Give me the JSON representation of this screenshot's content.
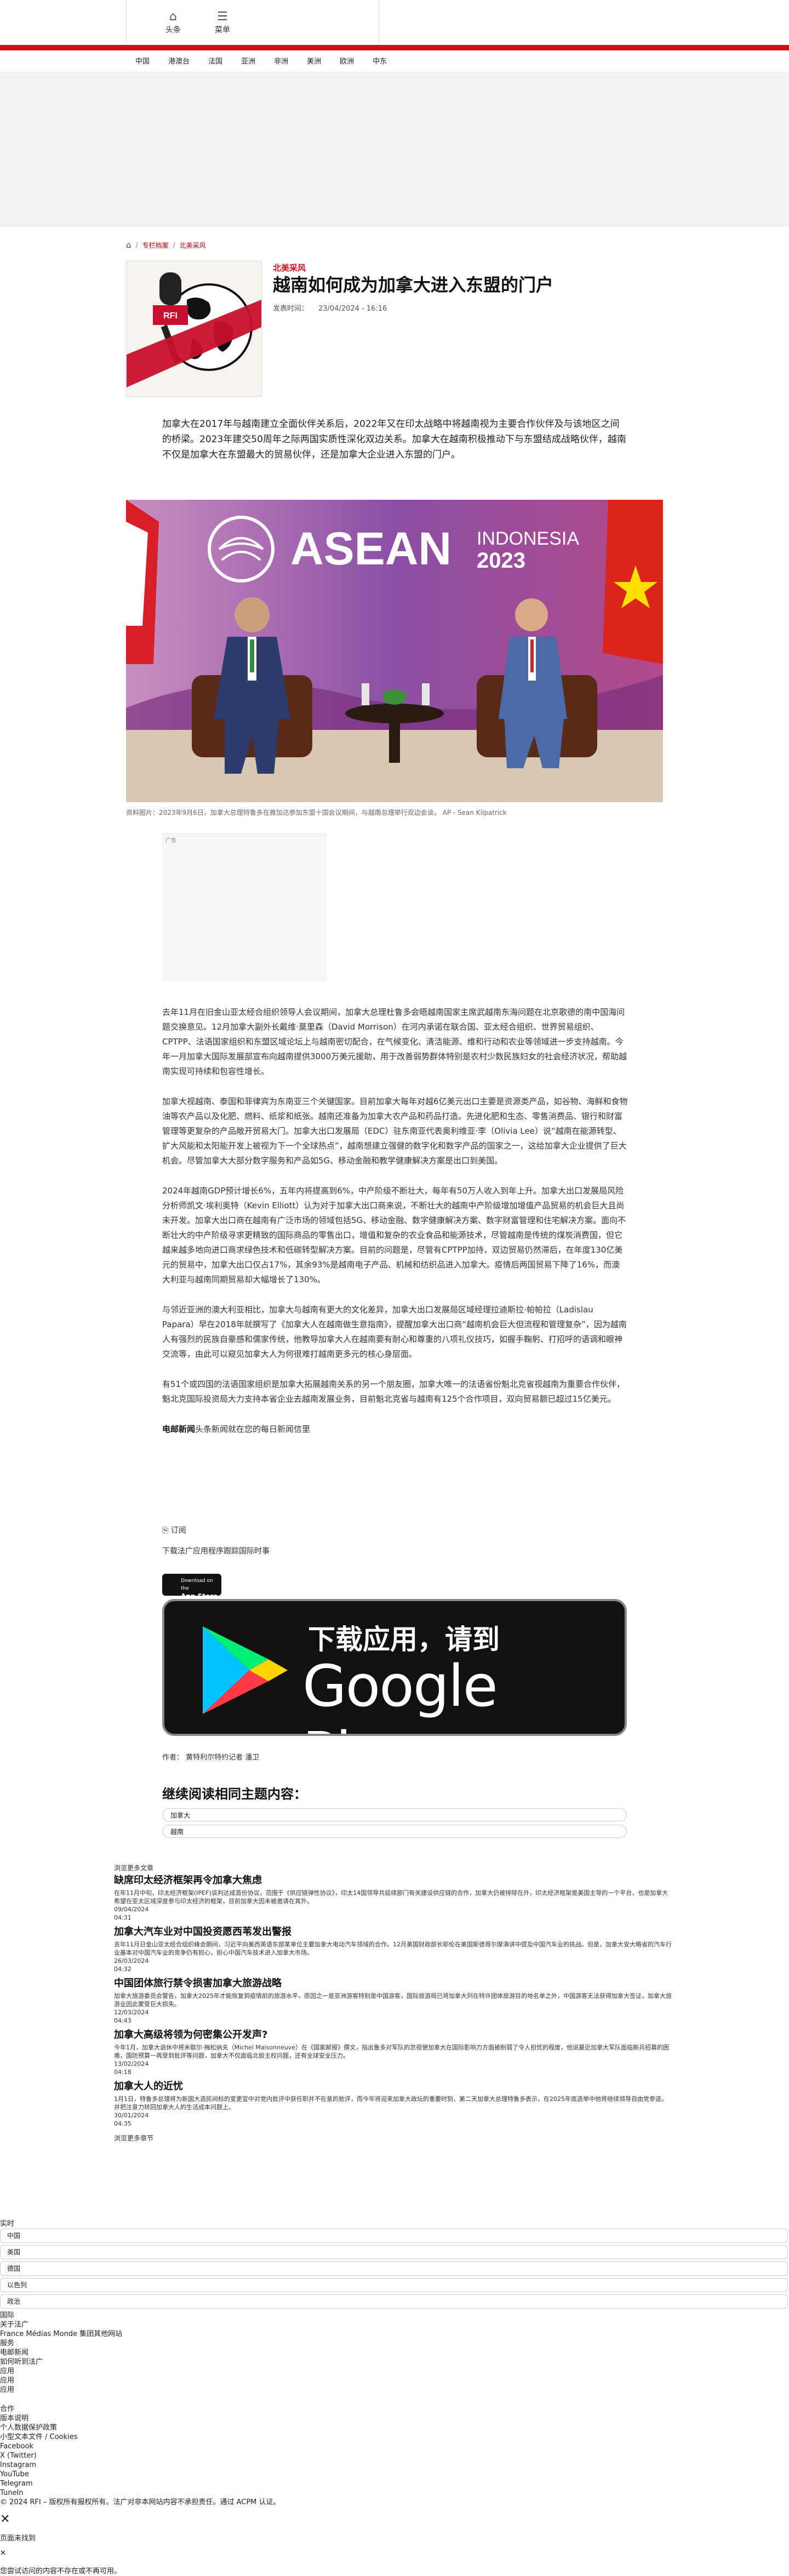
{
  "header": {
    "home_label": "头条",
    "menu_label": "菜单",
    "nav": [
      "中国",
      "港澳台",
      "法国",
      "亚洲",
      "非洲",
      "美洲",
      "欧洲",
      "中东"
    ]
  },
  "breadcrumb": {
    "items": [
      "专栏档案",
      "北美采风"
    ]
  },
  "article": {
    "section": "北美采风",
    "title": "越南如何成为加拿大进入东盟的门户",
    "published_label": "发表时间：",
    "published_date": "23/04/2024 - 16:16",
    "lead": "加拿大在2017年与越南建立全面伙伴关系后，2022年又在印太战略中将越南视为主要合作伙伴及与该地区之间的桥梁。2023年建交50周年之际两国实质性深化双边关系。加拿大在越南积极推动下与东盟结成战略伙伴，越南不仅是加拿大在东盟最大的贸易伙伴，还是加拿大企业进入东盟的门户。",
    "hero_banner_main": "ASEAN",
    "hero_banner_side": "INDONESIA",
    "hero_banner_year": "2023",
    "caption": "资料图片：2023年9月6日，加拿大总理特鲁多在雅加达参加东盟十国会议期间，与越南总理举行双边会谈。 AP - Sean Kilpatrick",
    "ad_label": "广告",
    "paragraphs": [
      "去年11月在旧金山亚太经合组织领导人会议期间，加拿大总理杜鲁多会晤越南国家主席武越南东海问题在北京歌德的南中国海问题交换意见。12月加拿大副外长戴维·莫里森（David Morrison）在河内承诺在联合国、亚太经合组织、世界贸易组织、CPTPP、法语国家组织和东盟区域论坛上与越南密切配合，在气候变化、清洁能源、维和行动和农业等领域进一步支持越南。今年一月加拿大国际发展部宣布向越南提供3000万美元援助，用于改善弱势群体特别是农村少数民族妇女的社会经济状况，帮助越南实现可持续和包容性增长。",
      "加拿大视越南、泰国和菲律宾为东南亚三个关键国家。目前加拿大每年对越6亿美元出口主要是资源类产品，如谷物、海鲜和食物油等农产品以及化肥、燃料、纸浆和纸张。越南还准备为加拿大农产品和药品打造。先进化肥和生态、零售消费品、银行和财富管理等更复杂的产品敞开贸易大门。加拿大出口发展局（EDC）驻东南亚代表奥利维亚·李（Olivia Lee）说“越南在能源转型、扩大风能和太阳能开发上被视为下一个全球热点”，越南想建立强健的数字化和数字产品的国家之一，这给加拿大企业提供了巨大机会。尽管加拿大大部分数字服务和产品如5G、移动金融和教学健康解决方案是出口到美国。",
      "2024年越南GDP预计增长6%，五年内将提高到6%，中产阶级不断壮大，每年有50万人收入到年上升。加拿大出口发展局风险分析师凯文·埃利奥特（Kevin Elliott）认为对于加拿大出口商来说，不断壮大的越南中产阶级增加增值产品贸易的机会巨大且尚未开发。加拿大出口商在越南有广泛市场的领域包括5G、移动金融、数字健康解决方案、数字财富管理和住宅解决方案。面向不断壮大的中产阶级寻求更精致的国际商品的零售出口，增值和复杂的农业食品和能源技术，尽管越南是传统的煤炭消费国，但它越来越多地向进口商求绿色技术和低碳转型解决方案。目前的问题是，尽管有CPTPP加持，双边贸易仍然滞后，在年度130亿美元的贸易中，加拿大出口仅占17%，其余93%是越南电子产品、机械和纺织品进入加拿大。疫情后两国贸易下降了16%，而澳大利亚与越南同期贸易却大幅增长了130%。",
      "与邻近亚洲的澳大利亚相比，加拿大与越南有更大的文化差异，加拿大出口发展局区域经理拉迪斯拉·帕帕拉（Ladislau Papara）早在2018年就撰写了《加拿大人在越南做生意指南》，提醒加拿大出口商“越南机会巨大但流程和管理复杂”，因为越南人有强烈的民族自豪感和儒家传统，他教导加拿大人在越南要有耐心和尊重的八项礼仪技巧，如握手鞠躬、打招呼的语调和眼神交流等，由此可以窥见加拿大人为何很难打越南更多元的核心身层面。",
      "有51个或四国的法语国家组织是加拿大拓展越南关系的另一个朋友圈，加拿大唯一的法语省份魁北克省视越南为重要合作伙伴，魁北克国际投资局大力支持本省企业去越南发展业务，目前魁北克省与越南有125个合作项目，双向贸易额已超过15亿美元。"
    ],
    "newsletter_bold": "电邮新闻",
    "newsletter_text": "头条新闻就在您的每日新闻信里",
    "share_label": "订阅",
    "app_text": "下载法广应用程序跟踪国际时事",
    "app_store_small": "Download on the",
    "app_store_label": "App Store",
    "gplay_line1": "下载应用，请到",
    "gplay_line2": "Google Play",
    "author": "作者：   黄特利尔特约记者 潘卫"
  },
  "related": {
    "title": "继续阅读相同主题内容：",
    "tags": [
      "加拿大",
      "越南"
    ],
    "heading": "浏览更多文章",
    "items": [
      {
        "title": "缺席印太经济框架再令加拿大焦虑",
        "summary": "在年11月中旬，印太经济框架(IPEF)谈判达成首份协议，范围于《供应链弹性协议》，印太14国领导共延续部门有关建设供应链的合作，加拿大仍被排除在外，印太经济框架是美国主导的一个平台，也是加拿大希望在亚太区域深度参与印太经济的框架，目前加拿大因未被邀请在其外。",
        "date": "09/04/2024",
        "time": "04:31"
      },
      {
        "title": "加拿大汽车业对中国投资愿西苇发出警报",
        "summary": "去年11月日金山亚太经合组织峰会期间，习近平向美西英语东部某单位主要加拿大电动汽车领域的合作。12月美国财政部长耶伦在美国斯德哥尔摩演讲中提及中国汽车业的挑战。但是，加拿大安大略省的汽车行业基本对中国汽车业的竞争仍有担心，担心中国汽车技术进入加拿大市场。",
        "date": "26/03/2024",
        "time": "04:32"
      },
      {
        "title": "中国团体旅行禁令损害加拿大旅游战略",
        "summary": "加拿大旅游委员会警告，加拿大2025年才能恢复到疫情前的旅游水平，原因之一是亚洲游客特别是中国游客，国际旅游局已将加拿大列在特许团体旅游目的地名单之外，中国游客无法获得加拿大签证，加拿大旅游业因此蒙受巨大损失。",
        "date": "12/03/2024",
        "time": "04:43"
      },
      {
        "title": "加拿大高级将领为何密集公开发声?",
        "summary": "今年1月，加拿大退休中将米歇尔·梅松纳夫（Michel Maisonneuve）在《国家邮报》撰文，指出鲁多对军队的忽视使加拿大在国际影响力方面被削弱了令人担忧的程度，他说最近加拿大军队面临新兵招募的困难，国防预算一再受到批评等问题，加拿大不仅面临北极主权问题，还有全球安全压力。",
        "date": "13/02/2024",
        "time": "04:18"
      },
      {
        "title": "加拿大人的近忧",
        "summary": "1月1日，特鲁多总理将为新国大选民间标的变更宣中对党内批评中获任职并不在意的批评，而今年将迎来加拿大政坛的重要时刻，第二天加拿大总理特鲁多表示，在2025年底选举中他将继续领导自由党参选，并把注意力转回加拿大人的生活成本问题上。",
        "date": "30/01/2024",
        "time": "04:35"
      }
    ],
    "more": "浏览更多章节"
  },
  "footer": {
    "realtime": "实时",
    "selects": [
      "中国",
      "美国",
      "德国",
      "以色列",
      "政治"
    ],
    "lines": [
      "国际",
      "关于法广",
      "France Médias Monde 集团其他网站",
      "服务",
      "电邮新闻",
      "如何听到法广",
      "应用",
      "应用",
      "应用",
      "合作",
      "版本说明",
      "个人数据保护政策",
      "小型文本文件 / Cookies",
      "Facebook",
      "X (Twitter)",
      "Instagram",
      "YouTube",
      "Telegram",
      "TuneIn",
      "© 2024 RFI – 版权所有报权所有。法广对非本网站内容不承担责任。通过 ACPM 认证。"
    ],
    "not_found": "页面未找到",
    "not_found_desc": "您尝试访问的内容不存在或不再可用。"
  }
}
